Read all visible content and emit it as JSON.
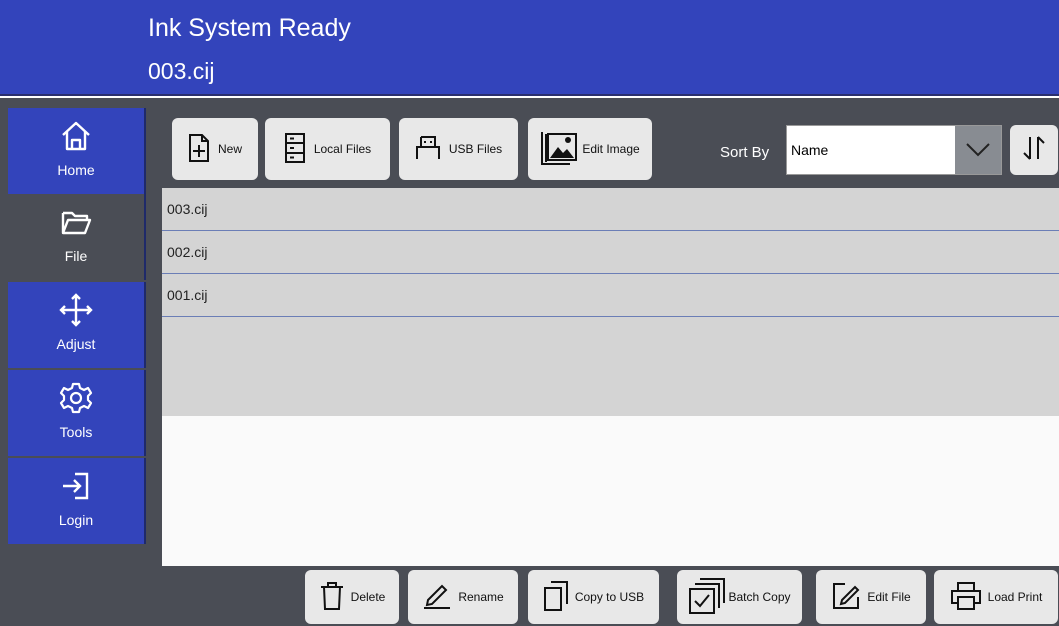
{
  "header": {
    "status": "Ink System Ready",
    "file": "003.cij"
  },
  "sidebar": {
    "items": [
      {
        "label": "Home",
        "icon": "home-icon",
        "active": false
      },
      {
        "label": "File",
        "icon": "folder-icon",
        "active": true
      },
      {
        "label": "Adjust",
        "icon": "move-arrows-icon",
        "active": false
      },
      {
        "label": "Tools",
        "icon": "gear-icon",
        "active": false
      },
      {
        "label": "Login",
        "icon": "login-icon",
        "active": false
      }
    ]
  },
  "toolbar": {
    "new_label": "New",
    "local_files_label": "Local Files",
    "usb_files_label": "USB Files",
    "edit_image_label": "Edit Image",
    "sort_by_label": "Sort By",
    "sort_value": "Name"
  },
  "files": [
    "003.cij",
    "002.cij",
    "001.cij"
  ],
  "actions": {
    "delete": "Delete",
    "rename": "Rename",
    "copy_to_usb": "Copy to USB",
    "batch_copy": "Batch Copy",
    "edit_file": "Edit File",
    "load_print": "Load Print"
  },
  "colors": {
    "header": "#3344bb",
    "panel": "#4a4d55",
    "button": "#e8e8e8",
    "list": "#d4d4d4"
  }
}
